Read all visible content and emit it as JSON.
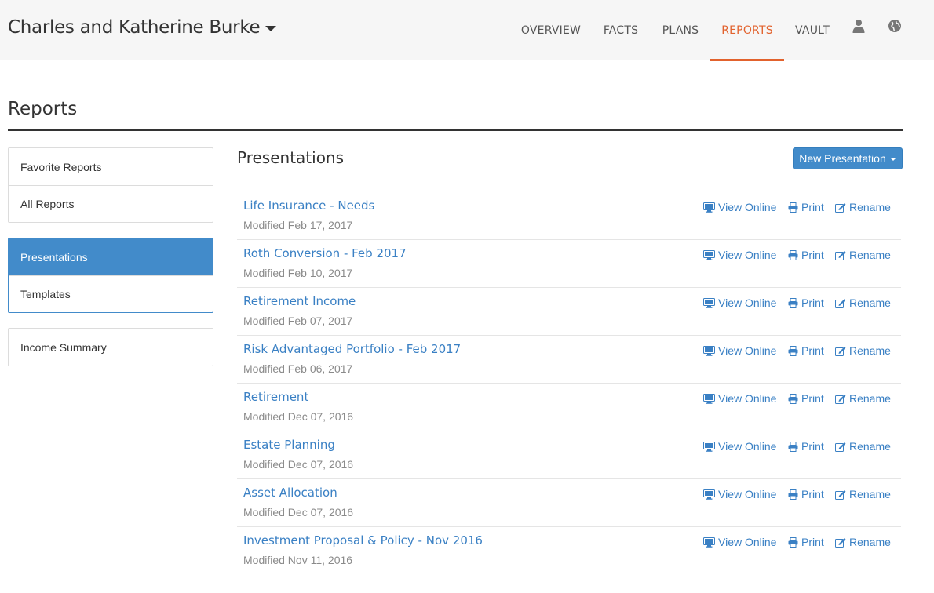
{
  "header": {
    "client_name": "Charles and Katherine Burke",
    "nav": [
      {
        "label": "OVERVIEW"
      },
      {
        "label": "FACTS"
      },
      {
        "label": "PLANS"
      },
      {
        "label": "REPORTS"
      },
      {
        "label": "VAULT"
      }
    ],
    "icons": [
      "user-icon",
      "globe-icon"
    ],
    "active_nav": "REPORTS"
  },
  "page": {
    "title": "Reports"
  },
  "sidebar": {
    "groups": [
      {
        "items": [
          {
            "label": "Favorite Reports"
          },
          {
            "label": "All Reports"
          }
        ]
      },
      {
        "items": [
          {
            "label": "Presentations"
          },
          {
            "label": "Templates"
          }
        ]
      },
      {
        "items": [
          {
            "label": "Income Summary"
          }
        ]
      }
    ],
    "active": "Presentations"
  },
  "main": {
    "section_title": "Presentations",
    "new_button_label": "New Presentation",
    "actions": {
      "view": "View Online",
      "print": "Print",
      "rename": "Rename"
    },
    "presentations": [
      {
        "title": "Life Insurance - Needs",
        "modified": "Modified Feb 17, 2017"
      },
      {
        "title": "Roth Conversion - Feb 2017",
        "modified": "Modified Feb 10, 2017"
      },
      {
        "title": "Retirement Income",
        "modified": "Modified Feb 07, 2017"
      },
      {
        "title": "Risk Advantaged Portfolio - Feb 2017",
        "modified": "Modified Feb 06, 2017"
      },
      {
        "title": "Retirement",
        "modified": "Modified Dec 07, 2016"
      },
      {
        "title": "Estate Planning",
        "modified": "Modified Dec 07, 2016"
      },
      {
        "title": "Asset Allocation",
        "modified": "Modified Dec 07, 2016"
      },
      {
        "title": "Investment Proposal & Policy - Nov 2016",
        "modified": "Modified Nov 11, 2016"
      }
    ]
  },
  "colors": {
    "accent": "#e2622d",
    "link": "#3a80c4",
    "primary": "#428bca"
  }
}
